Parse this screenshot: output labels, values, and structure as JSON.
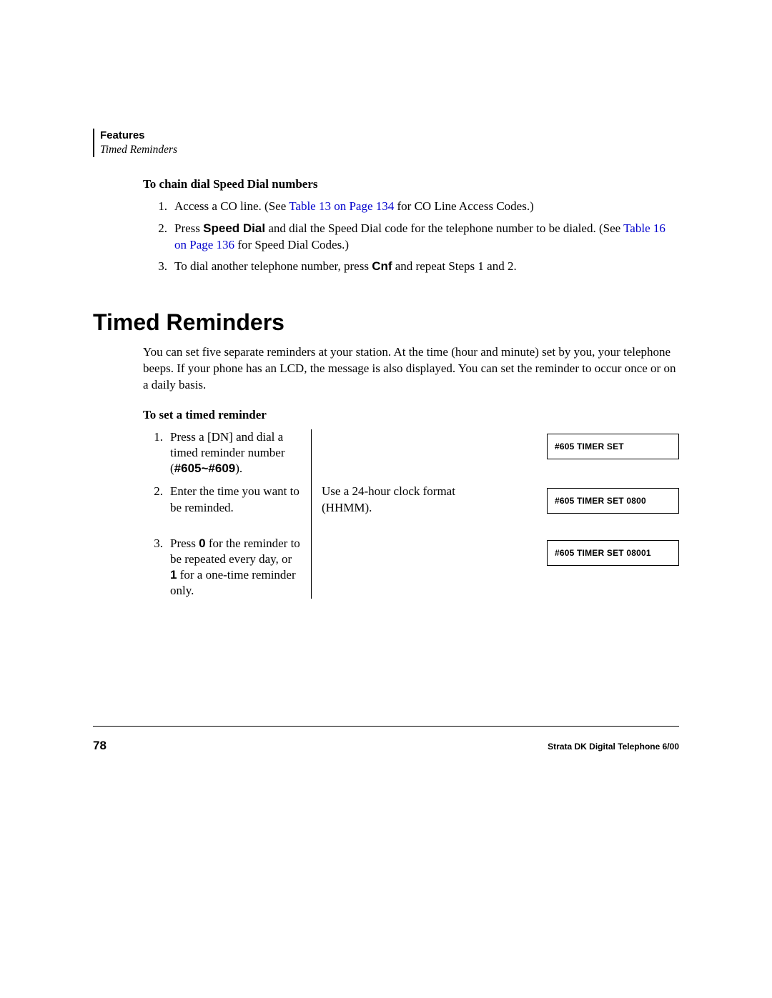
{
  "header": {
    "chapter": "Features",
    "section": "Timed Reminders"
  },
  "chain_dial": {
    "heading": "To chain dial Speed Dial numbers",
    "step1_a": "Access a CO line. (See ",
    "step1_link": "Table 13 on Page 134",
    "step1_b": " for CO Line Access Codes.)",
    "step2_a": "Press ",
    "step2_key": "Speed Dial",
    "step2_b": " and dial the Speed Dial code for the telephone number to be dialed. (See ",
    "step2_link": "Table 16 on Page 136",
    "step2_c": " for Speed Dial Codes.)",
    "step3_a": "To dial another telephone number, press ",
    "step3_key": "Cnf",
    "step3_b": " and repeat Steps 1 and 2."
  },
  "timed": {
    "title": "Timed Reminders",
    "intro": "You can set five separate reminders at your station. At the time (hour and minute) set by you, your telephone beeps. If your phone has an LCD, the message is also displayed. You can set the reminder to occur once or on a daily basis.",
    "subhead": "To set a timed reminder",
    "step1_a": "Press a [DN] and dial a timed reminder number",
    "step1_paren_open": "(",
    "step1_code": "#605~#609",
    "step1_paren_close": ").",
    "step1_lcd": "#605 TIMER SET",
    "step2_left": "Enter the time you want to be reminded.",
    "step2_mid": "Use a 24-hour clock format (HHMM).",
    "step2_lcd": "#605 TIMER SET 0800",
    "step3_a": "Press ",
    "step3_key0": "0",
    "step3_b": " for the reminder to be repeated every day, or ",
    "step3_key1": "1",
    "step3_c": " for a one-time reminder only.",
    "step3_lcd": "#605 TIMER SET 08001"
  },
  "nums": {
    "n1": "1.",
    "n2": "2.",
    "n3": "3."
  },
  "footer": {
    "page": "78",
    "doc": "Strata DK Digital Telephone  6/00"
  }
}
